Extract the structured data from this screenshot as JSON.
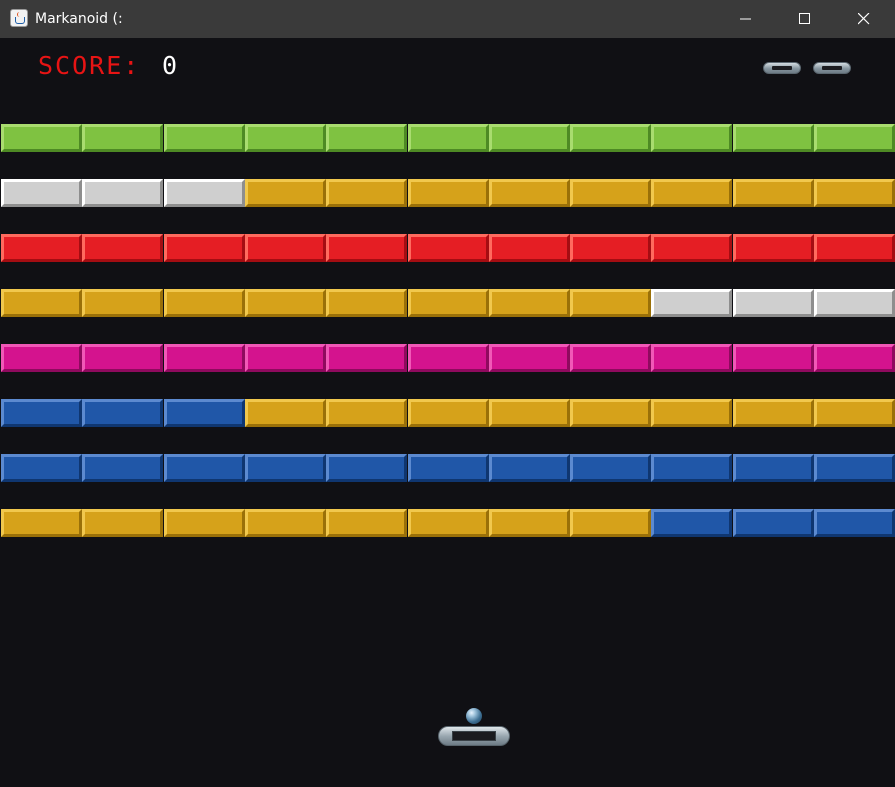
{
  "window": {
    "title": "Markanoid (:"
  },
  "hud": {
    "score_label": "SCORE:",
    "score_value": "0",
    "lives": 2
  },
  "palette": {
    "green": {
      "face": "#7fc241",
      "light": "#a9dc6f",
      "dark": "#4e8a24"
    },
    "silver": {
      "face": "#cfcfcf",
      "light": "#ffffff",
      "dark": "#8e8e8e"
    },
    "gold": {
      "face": "#d6a21a",
      "light": "#f1c84d",
      "dark": "#9a7008"
    },
    "red": {
      "face": "#e51e24",
      "light": "#ff6a5e",
      "dark": "#a50d12"
    },
    "pink": {
      "face": "#d4138e",
      "light": "#f158b7",
      "dark": "#8f0a5e"
    },
    "blue": {
      "face": "#2057a8",
      "light": "#5c8ad0",
      "dark": "#0f3670"
    }
  },
  "brick_rows": [
    [
      "green",
      "green",
      "green",
      "green",
      "green",
      "green",
      "green",
      "green",
      "green",
      "green",
      "green"
    ],
    [
      "silver",
      "silver",
      "silver",
      "gold",
      "gold",
      "gold",
      "gold",
      "gold",
      "gold",
      "gold",
      "gold"
    ],
    [
      "red",
      "red",
      "red",
      "red",
      "red",
      "red",
      "red",
      "red",
      "red",
      "red",
      "red"
    ],
    [
      "gold",
      "gold",
      "gold",
      "gold",
      "gold",
      "gold",
      "gold",
      "gold",
      "silver",
      "silver",
      "silver"
    ],
    [
      "pink",
      "pink",
      "pink",
      "pink",
      "pink",
      "pink",
      "pink",
      "pink",
      "pink",
      "pink",
      "pink"
    ],
    [
      "blue",
      "blue",
      "blue",
      "gold",
      "gold",
      "gold",
      "gold",
      "gold",
      "gold",
      "gold",
      "gold"
    ],
    [
      "blue",
      "blue",
      "blue",
      "blue",
      "blue",
      "blue",
      "blue",
      "blue",
      "blue",
      "blue",
      "blue"
    ],
    [
      "gold",
      "gold",
      "gold",
      "gold",
      "gold",
      "gold",
      "gold",
      "gold",
      "blue",
      "blue",
      "blue"
    ]
  ]
}
